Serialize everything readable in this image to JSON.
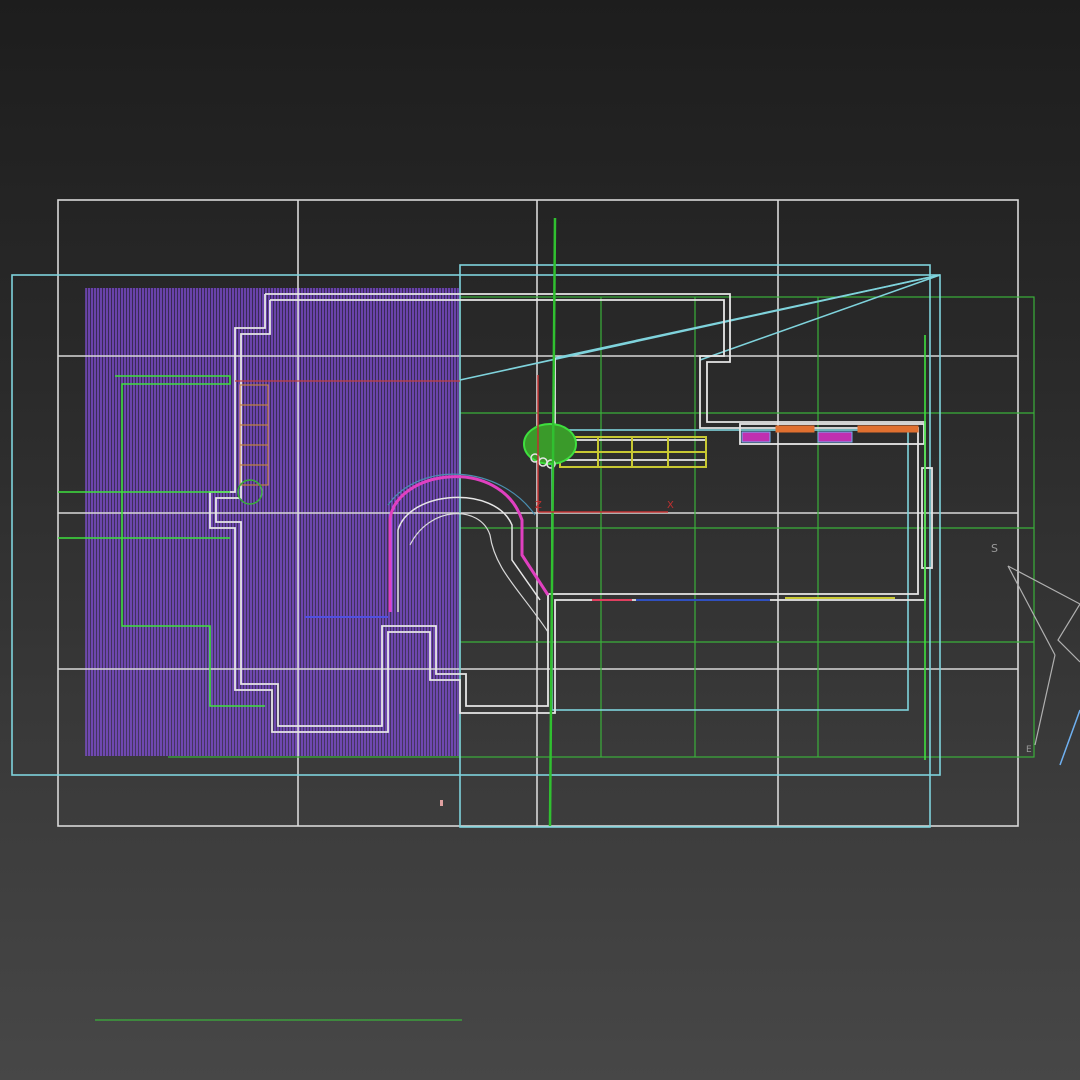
{
  "viewport": {
    "view": "Top",
    "shading": "Wireframe"
  },
  "colors": {
    "background_top": "#1d1d1d",
    "background_bottom": "#474747",
    "home_grid": "#d8d8d8",
    "cyan_wire": "#7fd3dc",
    "green_wire": "#3ab03a",
    "bright_green_wire": "#3ee03e",
    "purple_hatch": "#9a5cff",
    "magenta_wire": "#e040c0",
    "yellow_wire": "#c8c832",
    "axis_red": "#c03030",
    "axis_green": "#30c030"
  },
  "axis_labels": {
    "x": "X",
    "z": "Z"
  },
  "camera_labels": {
    "start": "S",
    "end": "E"
  }
}
